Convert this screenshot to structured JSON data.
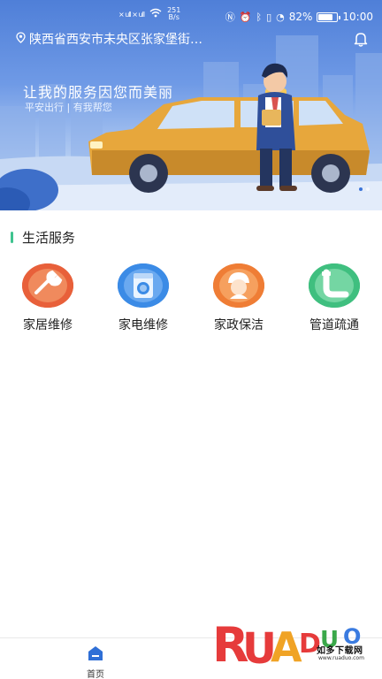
{
  "status_bar": {
    "signal_text": "× ull × ull",
    "net_rate_value": "251",
    "net_rate_unit": "B/s",
    "battery_percent": "82%",
    "battery_level": 0.82,
    "time": "10:00"
  },
  "header": {
    "location_text": "陕西省西安市未央区张家堡街…"
  },
  "banner": {
    "slogan": "让我的服务因您而美丽",
    "sub_slogan": "平安出行 | 有我帮您"
  },
  "section": {
    "title": "生活服务",
    "accent_color": "#3fc38f"
  },
  "services": [
    {
      "label": "家居维修",
      "icon": "wrench-icon",
      "color": "#e8603a"
    },
    {
      "label": "家电维修",
      "icon": "washing-machine-icon",
      "color": "#3b8be6"
    },
    {
      "label": "家政保洁",
      "icon": "housekeeper-icon",
      "color": "#ef7d35"
    },
    {
      "label": "管道疏通",
      "icon": "pipe-icon",
      "color": "#3fbf7f"
    }
  ],
  "bottom_nav": {
    "home_label": "首页",
    "active_color": "#2f6fd6"
  },
  "watermark": {
    "logo_text": "RUANDUO",
    "cn_text": "如多下载网",
    "url": "www.ruaduo.com"
  }
}
